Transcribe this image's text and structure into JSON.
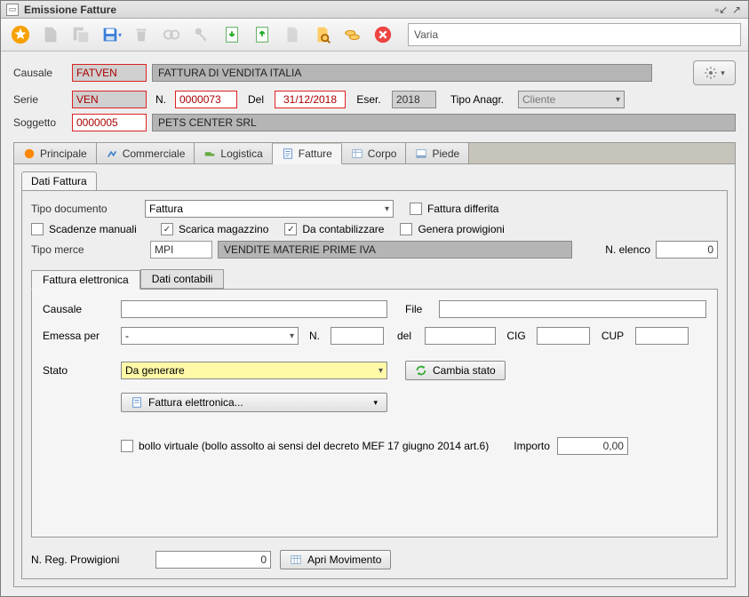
{
  "window": {
    "title": "Emissione Fatture"
  },
  "search": {
    "placeholder": "Varia"
  },
  "header": {
    "causale_label": "Causale",
    "causale_value": "FATVEN",
    "causale_desc": "FATTURA DI VENDITA ITALIA",
    "serie_label": "Serie",
    "serie_value": "VEN",
    "n_label": "N.",
    "n_value": "0000073",
    "del_label": "Del",
    "del_value": "31/12/2018",
    "eser_label": "Eser.",
    "eser_value": "2018",
    "tipo_anagr_label": "Tipo Anagr.",
    "tipo_anagr_value": "Cliente",
    "soggetto_label": "Soggetto",
    "soggetto_value": "0000005",
    "soggetto_desc": "PETS CENTER SRL"
  },
  "tabs": {
    "principale": "Principale",
    "commerciale": "Commerciale",
    "logistica": "Logistica",
    "fatture": "Fatture",
    "corpo": "Corpo",
    "piede": "Piede"
  },
  "dati_fattura_tab": "Dati Fattura",
  "form": {
    "tipo_documento_label": "Tipo documento",
    "tipo_documento_value": "Fattura",
    "fattura_differita_label": "Fattura differita",
    "scadenze_manuali_label": "Scadenze manuali",
    "scarica_magazzino_label": "Scarica magazzino",
    "scarica_magazzino_checked": "✓",
    "da_contabilizzare_label": "Da contabilizzare",
    "da_contabilizzare_checked": "✓",
    "genera_prowigioni_label": "Genera prowigioni",
    "tipo_merce_label": "Tipo merce",
    "tipo_merce_value": "MPI",
    "tipo_merce_desc": "VENDITE MATERIE PRIME IVA",
    "n_elenco_label": "N. elenco",
    "n_elenco_value": "0"
  },
  "fe": {
    "tab_fe": "Fattura elettronica",
    "tab_dc": "Dati contabili",
    "causale_label": "Causale",
    "emessa_per_label": "Emessa per",
    "emessa_per_value": "-",
    "n_label": "N.",
    "file_label": "File",
    "del_label": "del",
    "cig_label": "CIG",
    "cup_label": "CUP",
    "stato_label": "Stato",
    "stato_value": "Da generare",
    "cambia_stato": "Cambia stato",
    "fattura_elettronica_btn": "Fattura elettronica...",
    "bollo_label": "bollo virtuale (bollo assolto ai sensi del decreto MEF 17 giugno 2014 art.6)",
    "importo_label": "Importo",
    "importo_value": "0,00"
  },
  "footer": {
    "n_reg_label": "N. Reg. Prowigioni",
    "n_reg_value": "0",
    "apri_movimento": "Apri Movimento"
  }
}
